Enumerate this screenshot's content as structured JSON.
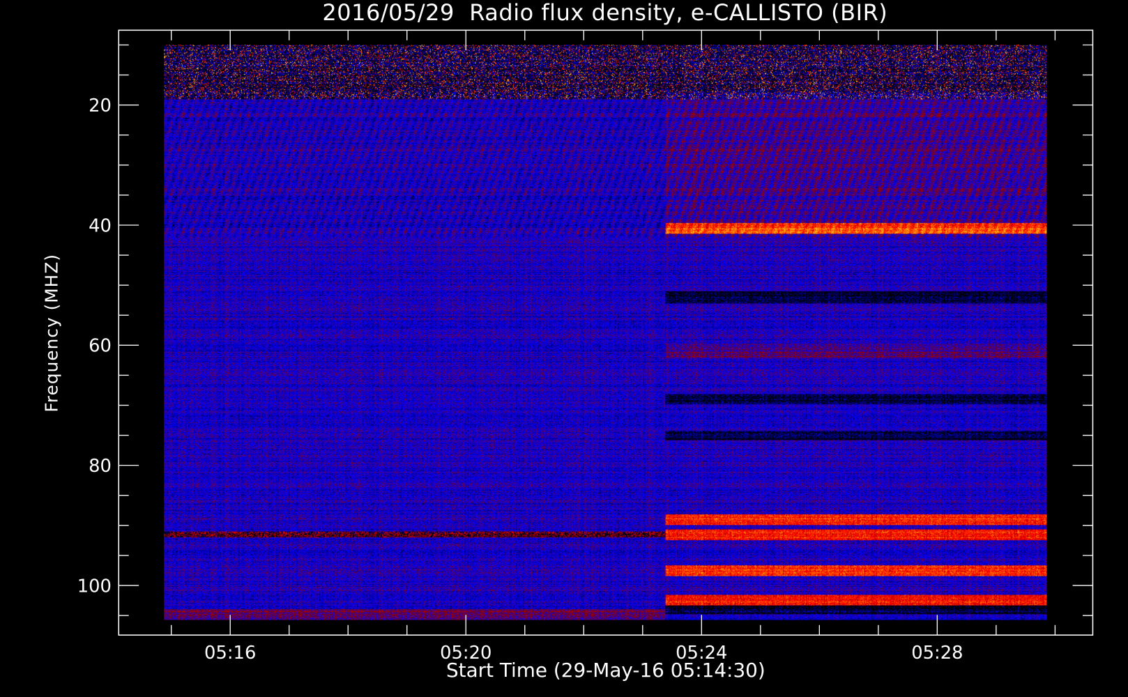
{
  "chart_data": {
    "type": "heatmap",
    "title": "2016/05/29  Radio flux density, e-CALLISTO (BIR)",
    "xlabel": "Start Time (29-May-16 05:14:30)",
    "ylabel": "Frequency (MHZ)",
    "ylim": [
      108.3,
      7.5
    ],
    "xlim_minutes_after_0516": [
      -1.89,
      14.63
    ],
    "data_extent": {
      "time_start": "05:14:53",
      "time_end": "05:29:52",
      "freq_min_mhz": 10,
      "freq_max_mhz": 105.8
    },
    "y_ticks": [
      20,
      40,
      60,
      80,
      100
    ],
    "y_minor_step": 5,
    "x_ticks": [
      {
        "label": "05:16",
        "minutes": 0
      },
      {
        "label": "05:20",
        "minutes": 4
      },
      {
        "label": "05:24",
        "minutes": 8
      },
      {
        "label": "05:28",
        "minutes": 12
      }
    ],
    "x_minor_step_minutes": 1,
    "colormap": [
      "#000000",
      "#0000ff",
      "#8b0000",
      "#ff0000",
      "#ffa500",
      "#ffff80"
    ],
    "background_change_at_minutes": 7.38,
    "bright_bands_mhz_after_change": [
      40.5,
      89,
      91.5,
      97.5,
      102.5
    ]
  }
}
